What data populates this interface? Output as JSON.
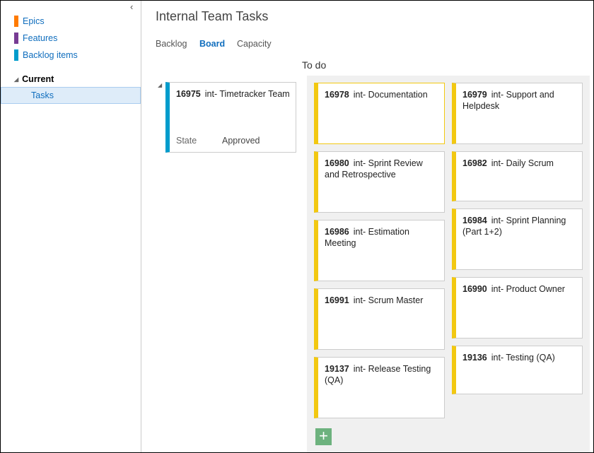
{
  "sidebar": {
    "collapse_icon": "chevron-left",
    "items": [
      {
        "label": "Epics",
        "color": "#ff7b00"
      },
      {
        "label": "Features",
        "color": "#773b93"
      },
      {
        "label": "Backlog items",
        "color": "#009ccc"
      }
    ],
    "current_label": "Current",
    "tasks_label": "Tasks"
  },
  "header": {
    "title": "Internal Team Tasks",
    "tabs": [
      {
        "label": "Backlog"
      },
      {
        "label": "Board",
        "active": true
      },
      {
        "label": "Capacity"
      }
    ]
  },
  "board": {
    "column": "To do",
    "task_color": "#f2c811",
    "parent": {
      "id": "16975",
      "title": "int- Timetracker Team",
      "state_label": "State",
      "state": "Approved",
      "color": "#009ccc"
    },
    "col1": [
      {
        "id": "16978",
        "title": "int- Documentation"
      },
      {
        "id": "16980",
        "title": "int- Sprint Review and Retrospective"
      },
      {
        "id": "16986",
        "title": "int- Estimation Meeting"
      },
      {
        "id": "16991",
        "title": "int- Scrum Master"
      },
      {
        "id": "19137",
        "title": "int- Release Testing (QA)"
      }
    ],
    "col2": [
      {
        "id": "16979",
        "title": "int- Support and Helpdesk"
      },
      {
        "id": "16982",
        "title": "int- Daily Scrum"
      },
      {
        "id": "16984",
        "title": "int- Sprint Planning (Part 1+2)"
      },
      {
        "id": "16990",
        "title": "int- Product Owner"
      },
      {
        "id": "19136",
        "title": "int- Testing (QA)"
      }
    ],
    "add_button": "+",
    "add_color": "#6db27e"
  }
}
